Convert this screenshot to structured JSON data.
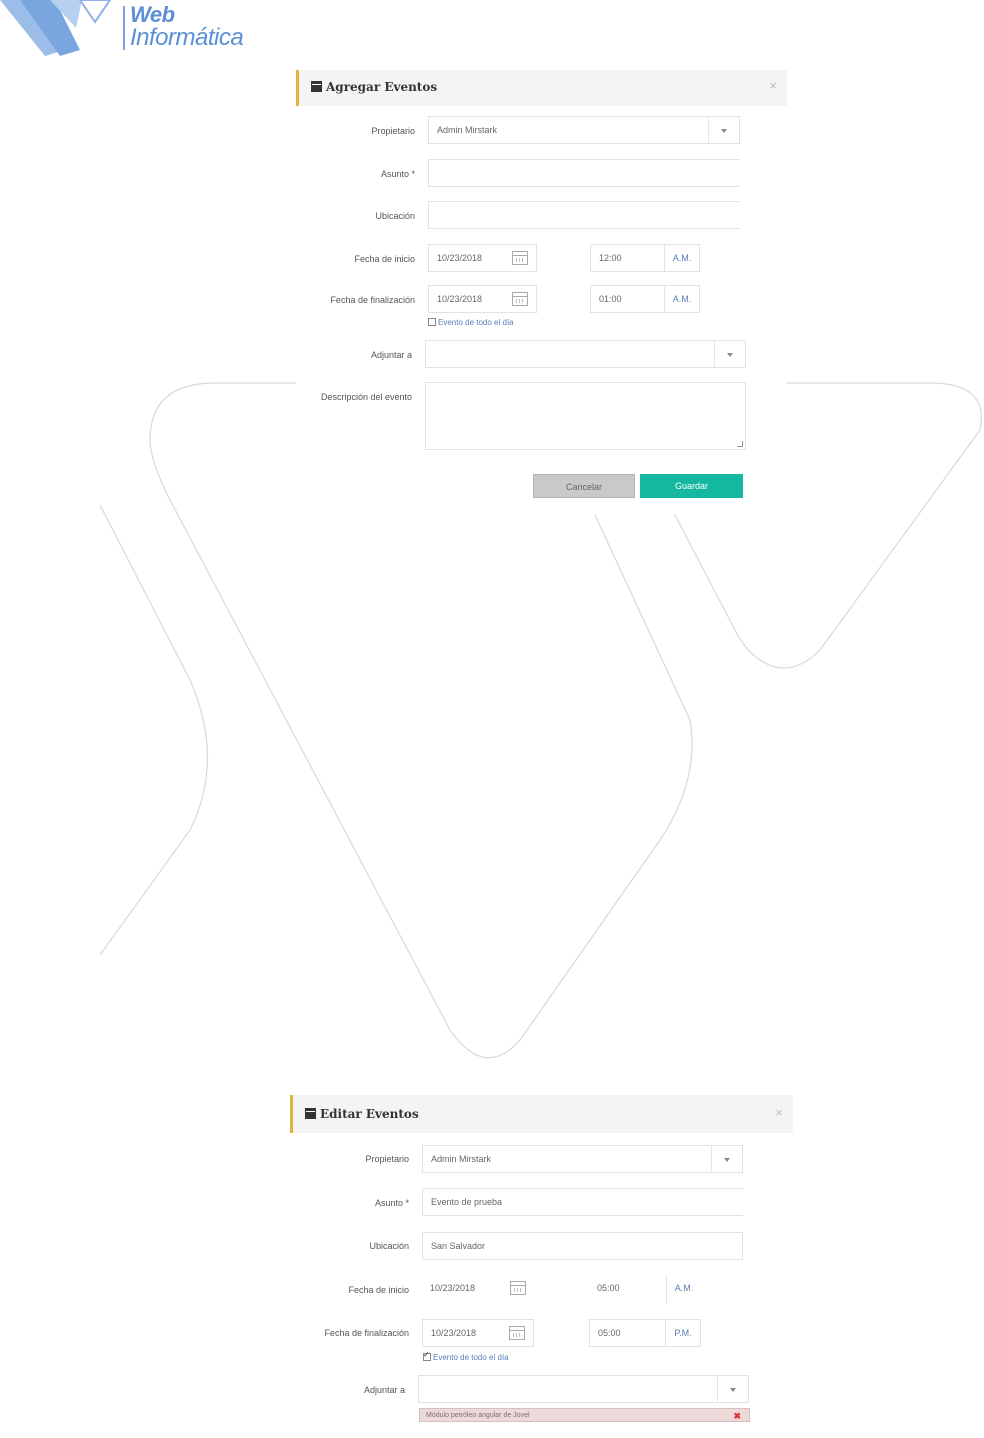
{
  "logo": {
    "line1": "Web",
    "line2": "Informática",
    "color": "#5b8fd6"
  },
  "add_modal": {
    "title": "Agregar Eventos",
    "close": "×",
    "labels": {
      "owner": "Propietario",
      "subject": "Asunto *",
      "location": "Ubicación",
      "start": "Fecha de inicio",
      "end": "Fecha de finalización",
      "attach": "Adjuntar a",
      "description": "Descripción del evento"
    },
    "owner_value": "Admin Mirstark",
    "subject_value": "",
    "location_value": "",
    "start_date": "10/23/2018",
    "start_time": "12:00",
    "start_ampm": "A.M.",
    "end_date": "10/23/2018",
    "end_time": "01:00",
    "end_ampm": "A.M.",
    "all_day_label": "Evento de todo el día",
    "all_day_checked": false,
    "cancel": "Cancelar",
    "save": "Guardar"
  },
  "edit_modal": {
    "title": "Editar Eventos",
    "close": "×",
    "labels": {
      "owner": "Propietario",
      "subject": "Asunto *",
      "location": "Ubicación",
      "start": "Fecha de inicio",
      "end": "Fecha de finalización",
      "attach": "Adjuntar a"
    },
    "owner_value": "Admin Mirstark",
    "subject_value": "Evento de prueba",
    "location_value": "San Salvador",
    "start_date": "10/23/2018",
    "start_time": "05:00",
    "start_ampm": "A.M.",
    "end_date": "10/23/2018",
    "end_time": "05:00",
    "end_ampm": "P.M.",
    "all_day_label": "Evento de todo el día",
    "all_day_checked": true,
    "attached_tag": "Módulo petróleo angular de Jovel",
    "tag_remove": "✖"
  },
  "colors": {
    "accent": "#e2b33c",
    "save": "#14b8a0",
    "cancel": "#c9c9c9"
  }
}
